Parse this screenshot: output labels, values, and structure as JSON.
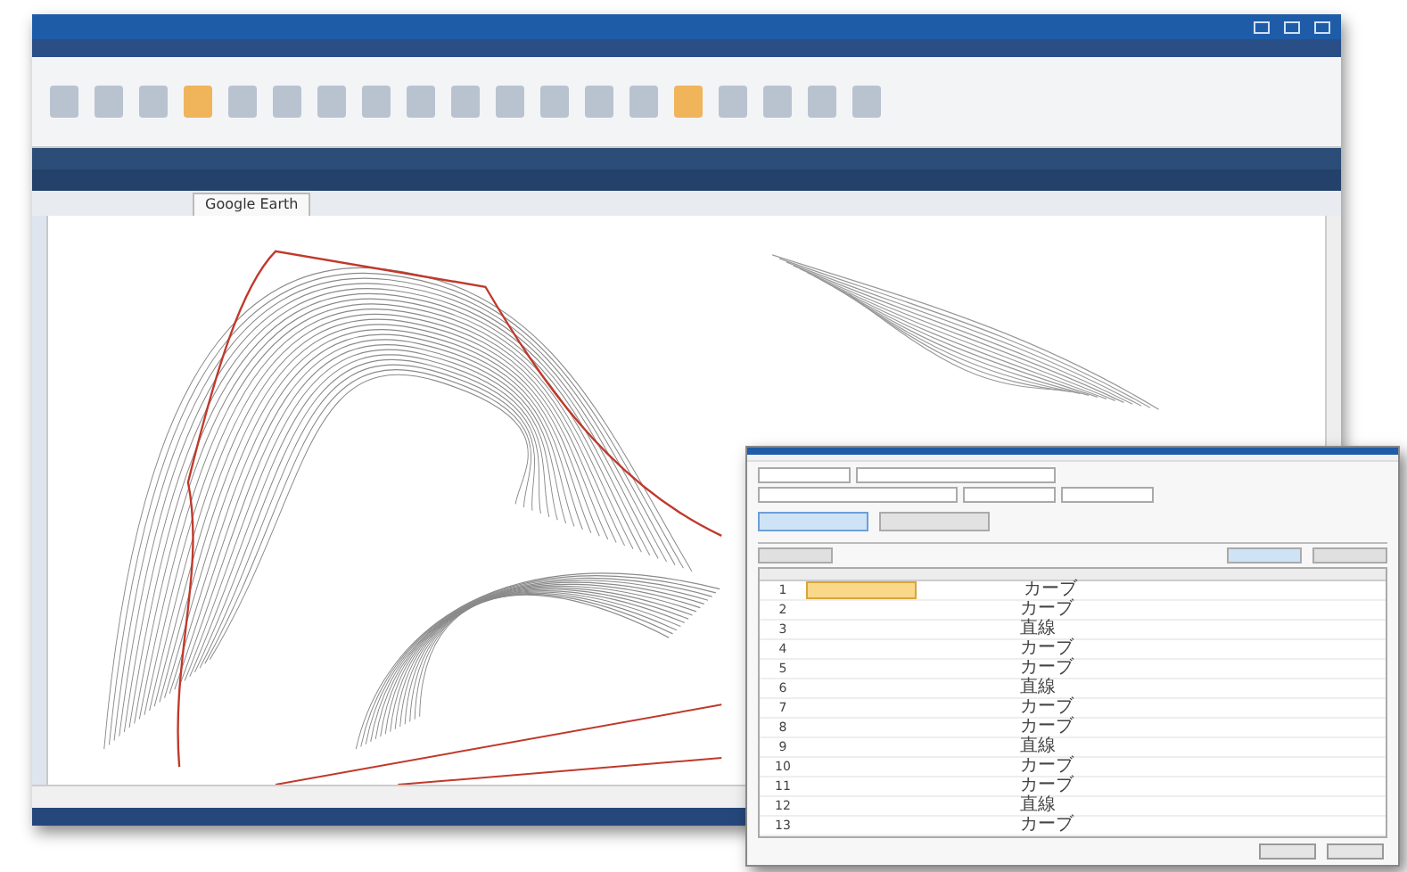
{
  "main_window": {
    "document_tabs": [
      {
        "label": "Google Earth",
        "selected": false
      }
    ]
  },
  "dialog": {
    "table": {
      "rows": [
        {
          "number": "1",
          "type": "カーブ",
          "selected": true
        },
        {
          "number": "2",
          "type": "カーブ",
          "selected": false
        },
        {
          "number": "3",
          "type": "直線",
          "selected": false
        },
        {
          "number": "4",
          "type": "カーブ",
          "selected": false
        },
        {
          "number": "5",
          "type": "カーブ",
          "selected": false
        },
        {
          "number": "6",
          "type": "直線",
          "selected": false
        },
        {
          "number": "7",
          "type": "カーブ",
          "selected": false
        },
        {
          "number": "8",
          "type": "カーブ",
          "selected": false
        },
        {
          "number": "9",
          "type": "直線",
          "selected": false
        },
        {
          "number": "10",
          "type": "カーブ",
          "selected": false
        },
        {
          "number": "11",
          "type": "カーブ",
          "selected": false
        },
        {
          "number": "12",
          "type": "直線",
          "selected": false
        },
        {
          "number": "13",
          "type": "カーブ",
          "selected": false
        }
      ]
    }
  }
}
